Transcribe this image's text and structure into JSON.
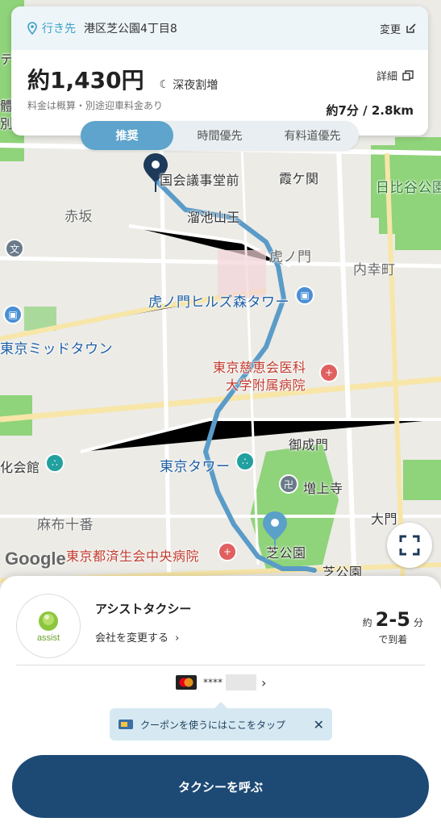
{
  "destination": {
    "label": "行き先",
    "value": "港区芝公園4丁目8",
    "change_label": "変更"
  },
  "fare": {
    "amount": "約1,430円",
    "night_label": "深夜割増",
    "note": "料金は概算・別途迎車料金あり",
    "detail_label": "詳細",
    "time_distance": "約7分 / 2.8km"
  },
  "tabs": [
    {
      "label": "推奨",
      "active": true
    },
    {
      "label": "時間優先",
      "active": false
    },
    {
      "label": "有料道優先",
      "active": false
    }
  ],
  "map": {
    "labels": {
      "kokkai": "国会議事堂前",
      "kasumigaseki": "霞ケ関",
      "hibiya": "日比谷公園",
      "akasaka": "赤坂",
      "tameike": "溜池山王",
      "toranomon": "虎ノ門",
      "uchisaiwai": "内幸町",
      "hills": "虎ノ門ヒルズ森タワー",
      "midtown": "東京ミッドタウン",
      "jikei": "東京慈恵会医科",
      "jikei2": "大学附属病院",
      "onarimon": "御成門",
      "tower": "東京タワー",
      "zojoji": "増上寺",
      "kaikan": "化会館",
      "azabu": "麻布十番",
      "daimon": "大門",
      "saiseikai": "東京都済生会中央病院",
      "shibakoen": "芝公園",
      "shibakoen2": "芝公園",
      "left_partial": "テ",
      "left_partial2": "體",
      "left_partial3": "別"
    },
    "google_logo": "Google",
    "colors": {
      "route": "#5a9bc8",
      "park": "#8fd37a"
    }
  },
  "company": {
    "logo_text": "assist",
    "name": "アシストタクシー",
    "change_label": "会社を変更する"
  },
  "eta": {
    "prefix": "約",
    "value": "2-5",
    "unit": "分",
    "suffix": "で到着"
  },
  "payment": {
    "card_mask": "****"
  },
  "coupon": {
    "text": "クーポンを使うにはここをタップ"
  },
  "call_button": {
    "label": "タクシーを呼ぶ"
  }
}
